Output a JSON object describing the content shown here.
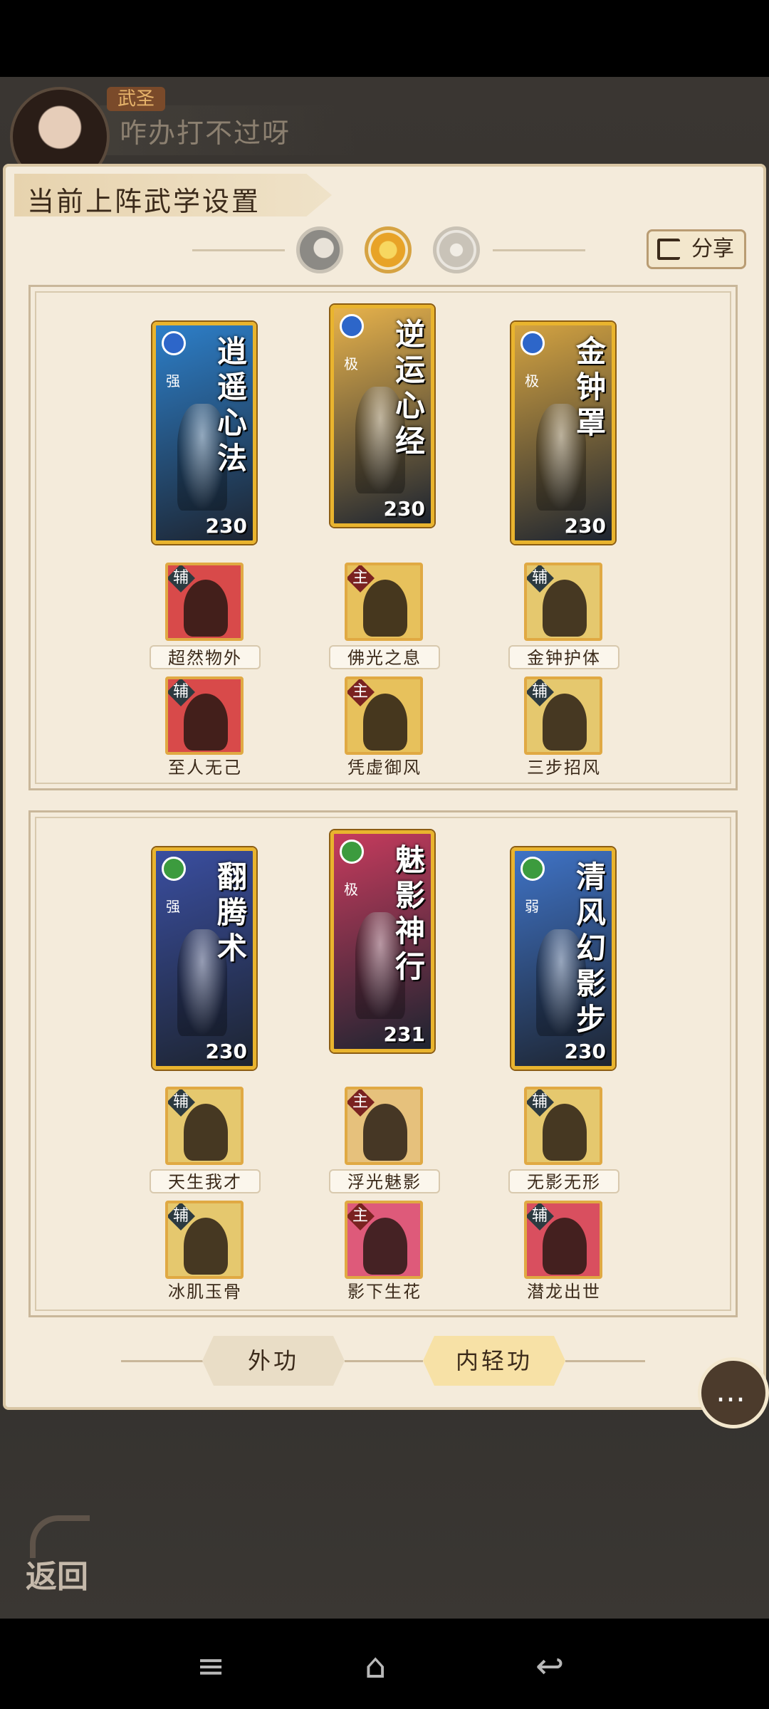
{
  "header": {
    "rank": "武圣",
    "message": "咋办打不过呀"
  },
  "panel": {
    "title": "当前上阵武学设置",
    "share_label": "分享",
    "modes": [
      "moon",
      "sun",
      "ring"
    ]
  },
  "sections": [
    {
      "cards": [
        {
          "title": "逍遥心法",
          "grade": "强",
          "power": "230",
          "tier_icon": "s-icon",
          "color": "#2d7fc9"
        },
        {
          "title": "逆运心经",
          "grade": "极",
          "power": "230",
          "tier_icon": "s-icon",
          "color": "#e7b24b"
        },
        {
          "title": "金钟罩",
          "grade": "极",
          "power": "230",
          "tier_icon": "s-icon",
          "color": "#d4a341"
        }
      ],
      "skills_row1": [
        {
          "badge": "辅",
          "name": "超然物外"
        },
        {
          "badge": "主",
          "name": "佛光之息"
        },
        {
          "badge": "辅",
          "name": "金钟护体"
        }
      ],
      "skills_row2": [
        {
          "badge": "辅",
          "name": "至人无己"
        },
        {
          "badge": "主",
          "name": "凭虚御风"
        },
        {
          "badge": "辅",
          "name": "三步招风"
        }
      ]
    },
    {
      "cards": [
        {
          "title": "翻腾术",
          "grade": "强",
          "power": "230",
          "tier_icon": "green-icon",
          "color": "#3a4ea0"
        },
        {
          "title": "魅影神行",
          "grade": "极",
          "power": "231",
          "tier_icon": "green-icon",
          "color": "#c63b5d"
        },
        {
          "title": "清风幻影步",
          "grade": "弱",
          "power": "230",
          "tier_icon": "green-icon",
          "color": "#3f73c6"
        }
      ],
      "skills_row1": [
        {
          "badge": "辅",
          "name": "天生我才"
        },
        {
          "badge": "主",
          "name": "浮光魅影"
        },
        {
          "badge": "辅",
          "name": "无影无形"
        }
      ],
      "skills_row2": [
        {
          "badge": "辅",
          "name": "冰肌玉骨"
        },
        {
          "badge": "主",
          "name": "影下生花"
        },
        {
          "badge": "辅",
          "name": "潜龙出世"
        }
      ]
    }
  ],
  "tabs": {
    "outer": "外功",
    "inner": "内轻功"
  },
  "back_label": "返回",
  "nav": [
    "menu-icon",
    "home-icon",
    "back-icon"
  ]
}
